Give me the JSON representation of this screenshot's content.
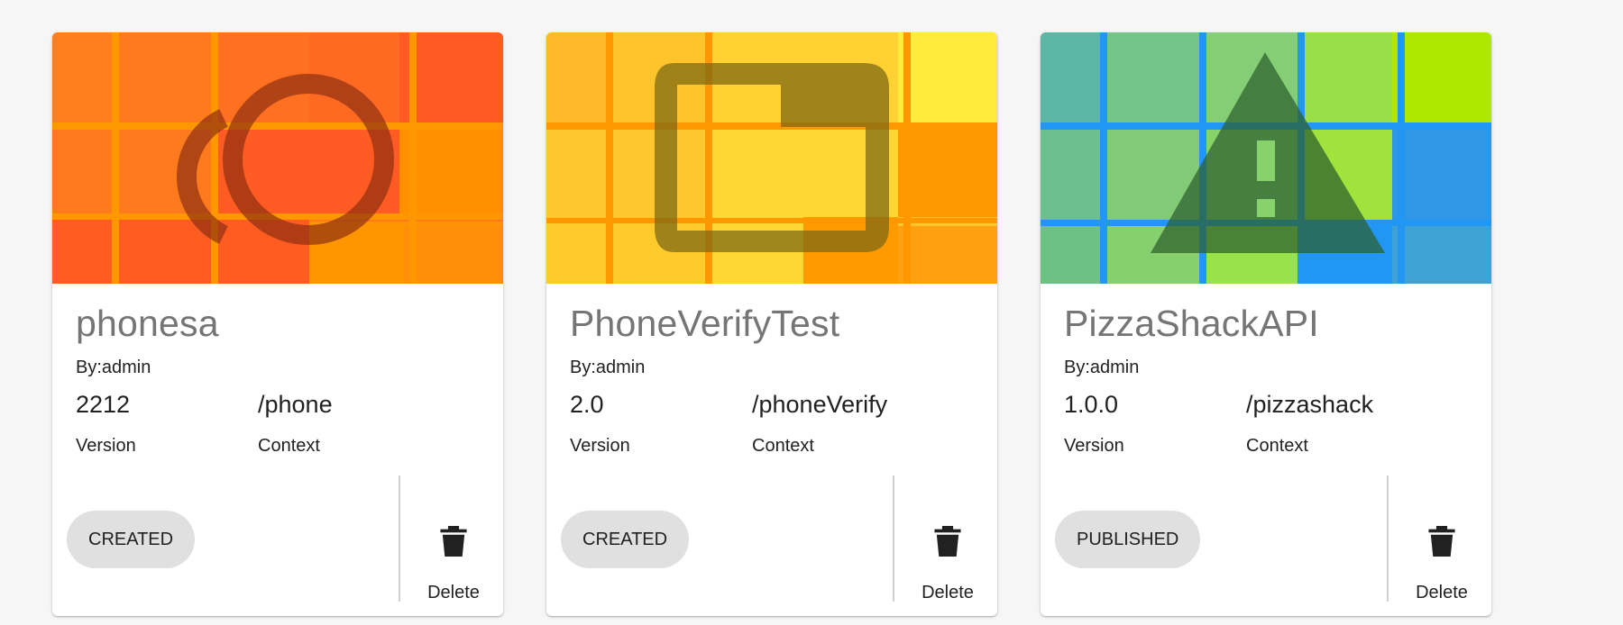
{
  "cards": [
    {
      "name": "phonesa",
      "author": "By:admin",
      "version": "2212",
      "context": "/phone",
      "version_label": "Version",
      "context_label": "Context",
      "status": "CREATED",
      "delete_label": "Delete",
      "thumbnail_icon": "copyright-icon",
      "palette": [
        "#ff7a1c",
        "#ff9200",
        "#ff5722",
        "#ff6d22"
      ]
    },
    {
      "name": "PhoneVerifyTest",
      "author": "By:admin",
      "version": "2.0",
      "context": "/phoneVerify",
      "version_label": "Version",
      "context_label": "Context",
      "status": "CREATED",
      "delete_label": "Delete",
      "thumbnail_icon": "tab-icon",
      "palette": [
        "#ffc42a",
        "#ff9800",
        "#fdd835",
        "#ffeb3b"
      ]
    },
    {
      "name": "PizzaShackAPI",
      "author": "By:admin",
      "version": "1.0.0",
      "context": "/pizzashack",
      "version_label": "Version",
      "context_label": "Context",
      "status": "PUBLISHED",
      "delete_label": "Delete",
      "thumbnail_icon": "warning-icon",
      "palette": [
        "#5bb6a6",
        "#7bc97f",
        "#9de248",
        "#2196f3"
      ]
    }
  ]
}
